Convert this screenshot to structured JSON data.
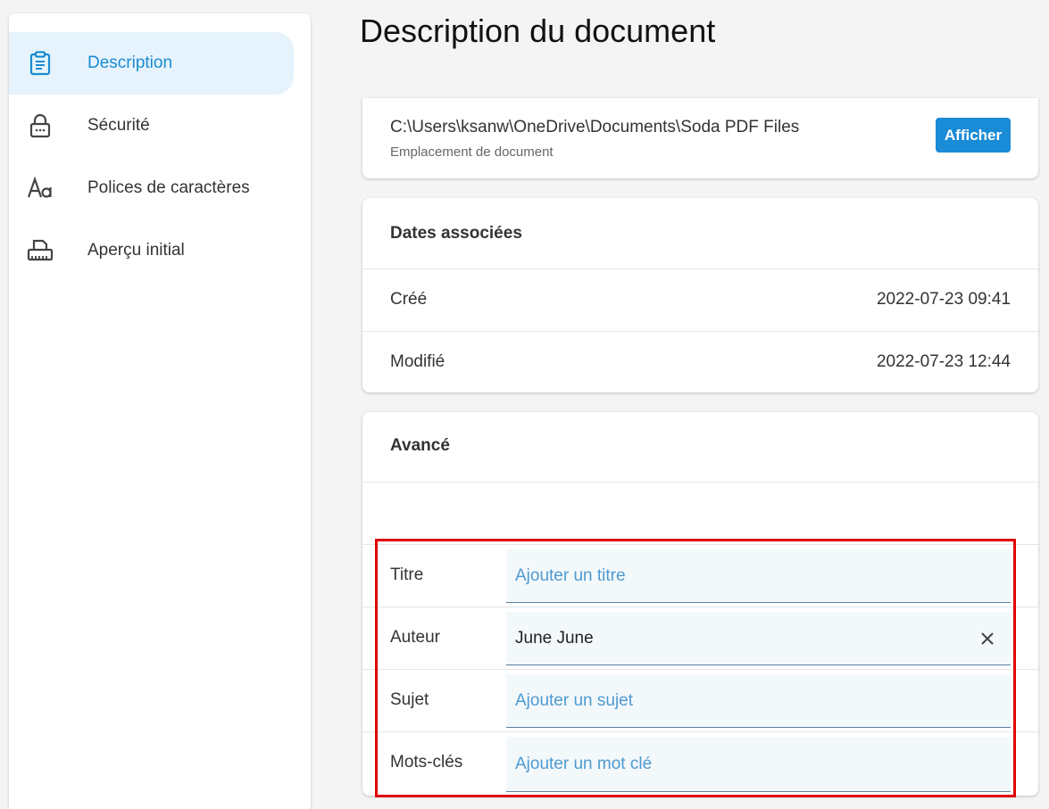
{
  "page_title": "Description du document",
  "sidebar": {
    "items": [
      {
        "label": "Description",
        "icon": "clipboard-icon",
        "active": true
      },
      {
        "label": "Sécurité",
        "icon": "lock-icon",
        "active": false
      },
      {
        "label": "Polices de caractères",
        "icon": "font-icon",
        "active": false
      },
      {
        "label": "Aperçu initial",
        "icon": "printer-icon",
        "active": false
      }
    ]
  },
  "location": {
    "path": "C:\\Users\\ksanw\\OneDrive\\Documents\\Soda PDF Files",
    "subtitle": "Emplacement de document",
    "button_label": "Afficher"
  },
  "dates": {
    "header": "Dates associées",
    "rows": [
      {
        "label": "Créé",
        "value": "2022-07-23 09:41"
      },
      {
        "label": "Modifié",
        "value": "2022-07-23 12:44"
      }
    ]
  },
  "advanced": {
    "header": "Avancé",
    "fields": [
      {
        "label": "Titre",
        "value": "",
        "placeholder": "Ajouter un titre"
      },
      {
        "label": "Auteur",
        "value": "June June",
        "placeholder": ""
      },
      {
        "label": "Sujet",
        "value": "",
        "placeholder": "Ajouter un sujet"
      },
      {
        "label": "Mots-clés",
        "value": "",
        "placeholder": "Ajouter un mot clé"
      }
    ]
  },
  "colors": {
    "accent": "#1a8bd6",
    "active_bg": "#e6f3fc",
    "highlight": "#e00000"
  }
}
